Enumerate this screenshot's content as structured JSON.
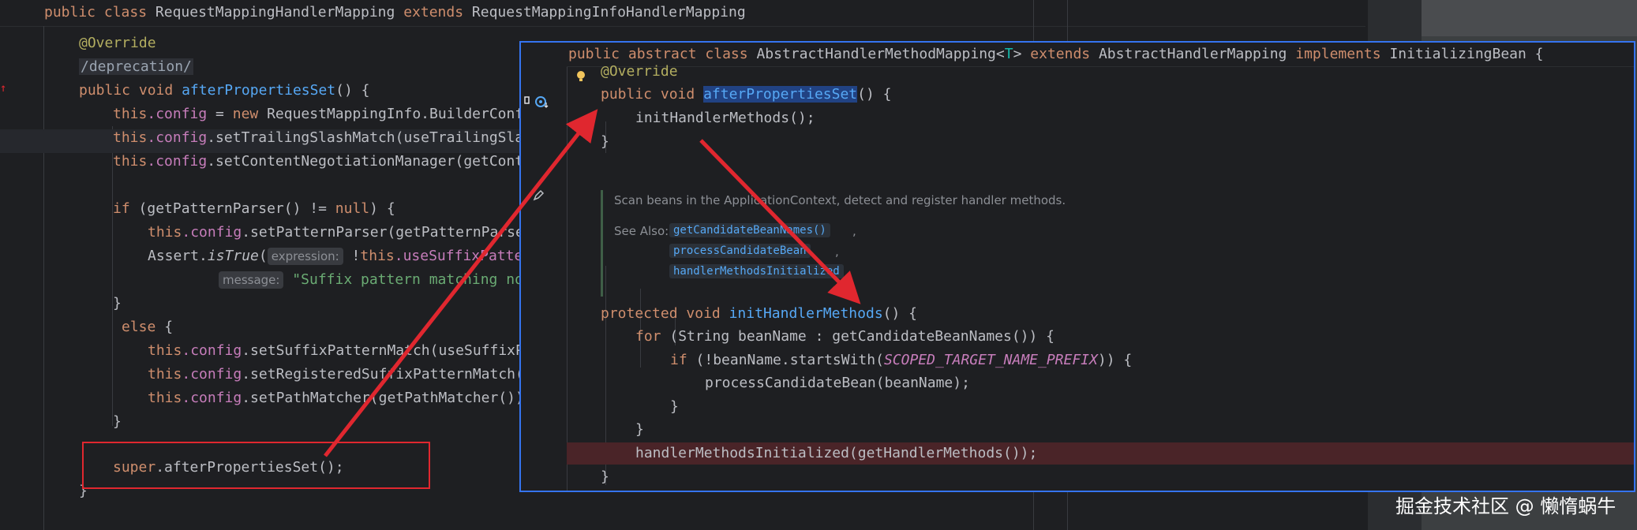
{
  "left": {
    "header": {
      "kw1": "public",
      "kw2": "class",
      "class_name": "RequestMappingHandlerMapping",
      "kw3": "extends",
      "parent": "RequestMappingInfoHandlerMapping"
    },
    "override": "@Override",
    "deprecation": "/deprecation/",
    "sig": {
      "kw1": "public",
      "kw2": "void",
      "name": "afterPropertiesSet",
      "rest": "() {"
    },
    "l1": {
      "this": "this",
      "field": ".config",
      "rest": " = ",
      "kw": "new",
      "rest2": " RequestMappingInfo.BuilderConf"
    },
    "l2": {
      "this": "this",
      "field": ".config",
      "rest": ".setTrailingSlashMatch(useTrailingSla"
    },
    "l3": {
      "this": "this",
      "field": ".config",
      "rest": ".setContentNegotiationManager(getCont"
    },
    "l4": {
      "kw": "if",
      "rest": " (getPatternParser() != ",
      "kw2": "null",
      "rest2": ") {"
    },
    "l5": {
      "this": "this",
      "field": ".config",
      "rest": ".setPatternParser(getPatternParse"
    },
    "l6": {
      "pre": "Assert.",
      "fn": "isTrue",
      "rest": "(",
      "hint": "expression:",
      "rest2": " !",
      "this": "this",
      "field": ".useSuffixPatte"
    },
    "l7": {
      "hint": "message:",
      "str": " \"Suffix pattern matching not"
    },
    "close1": "}",
    "else": "else",
    "else_brace": " {",
    "l8": {
      "this": "this",
      "field": ".config",
      "rest": ".setSuffixPatternMatch(useSuffixP"
    },
    "l9": {
      "this": "this",
      "field": ".config",
      "rest": ".setRegisteredSuffixPatternMatch("
    },
    "l10": {
      "this": "this",
      "field": ".config",
      "rest": ".setPathMatcher(getPathMatcher())"
    },
    "close2": "}",
    "super_line": {
      "kw": "super",
      "rest": ".afterPropertiesSet();"
    },
    "close3": "}"
  },
  "popup": {
    "header": {
      "kw1": "public",
      "kw2": "abstract",
      "kw3": "class",
      "name": "AbstractHandlerMethodMapping",
      "lt": "<",
      "tparam": "T",
      "gt": ">",
      "kw4": "extends",
      "parent": "AbstractHandlerMapping",
      "kw5": "implements",
      "iface": "InitializingBean",
      "brace": " {"
    },
    "override": "@Override",
    "sig": {
      "kw1": "public",
      "kw2": "void",
      "name": "afterPropertiesSet",
      "rest": "() {"
    },
    "call1": "initHandlerMethods();",
    "close1": "}",
    "doc": {
      "summary": "Scan beans in the ApplicationContext, detect and register handler methods.",
      "see_also": "See Also:",
      "link1": "getCandidateBeanNames()",
      "link2": "processCandidateBean",
      "link3": "handlerMethodsInitialized",
      "comma": ","
    },
    "sig2": {
      "kw1": "protected",
      "kw2": "void",
      "name": "initHandlerMethods",
      "rest": "() {"
    },
    "for_line": {
      "kw": "for",
      "rest": " (String beanName : getCandidateBeanNames()) {"
    },
    "if_line": {
      "kw": "if",
      "rest": " (!beanName.startsWith(",
      "const": "SCOPED_TARGET_NAME_PREFIX",
      "rest2": ")) {"
    },
    "process_line": "processCandidateBean(beanName);",
    "close_if": "}",
    "close_for": "}",
    "handler_line": "handlerMethodsInitialized(getHandlerMethods());",
    "close_method": "}"
  },
  "watermark": "掘金技术社区 @ 懒惰蜗牛",
  "colors": {
    "background": "#1e1f22",
    "keyword": "#cf8e6d",
    "function": "#56a8f5",
    "annotation": "#b3ae60",
    "string": "#6aab73",
    "field": "#c77dbb",
    "popup_border": "#3574f0",
    "error_line": "#4a2428",
    "arrow": "#e0272f"
  }
}
